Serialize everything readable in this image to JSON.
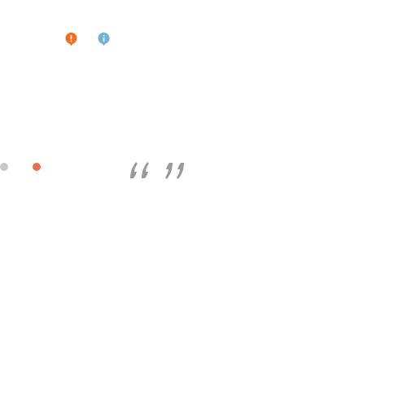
{
  "icons": {
    "alert": {
      "name": "alert-bubble-icon",
      "color": "#f36c21"
    },
    "info": {
      "name": "info-bubble-icon",
      "color": "#6fb5d1"
    },
    "open_quote": {
      "name": "open-quote-icon",
      "color": "#9a9a9a"
    },
    "close_quote": {
      "name": "close-quote-icon",
      "color": "#9a9a9a"
    }
  },
  "indicators": [
    {
      "name": "inactive-dot",
      "color": "#c8c8c8"
    },
    {
      "name": "active-dot",
      "color": "#ef6c50"
    }
  ]
}
